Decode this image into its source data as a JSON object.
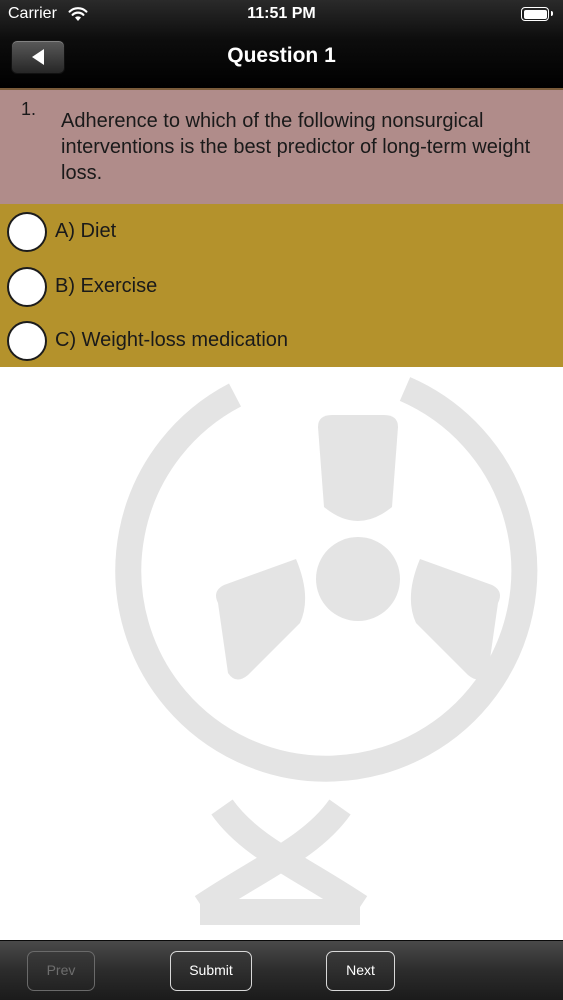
{
  "status_bar": {
    "carrier": "Carrier",
    "time": "11:51 PM",
    "wifi_icon": "wifi-icon",
    "battery_icon": "battery-icon"
  },
  "nav": {
    "title": "Question 1",
    "back_icon": "back-arrow-icon"
  },
  "question": {
    "number": "1.",
    "text": "Adherence to which of the following nonsurgical interventions is the best predictor of long-term weight loss."
  },
  "options": [
    {
      "label": "A) Diet",
      "selected": false
    },
    {
      "label": "B) Exercise",
      "selected": false
    },
    {
      "label": "C) Weight-loss medication",
      "selected": false
    }
  ],
  "toolbar": {
    "prev_label": "Prev",
    "prev_enabled": false,
    "submit_label": "Submit",
    "next_label": "Next"
  },
  "colors": {
    "question_bg": "#b08c8a",
    "options_bg": "#b4922c",
    "watermark": "#e4e4e4"
  }
}
